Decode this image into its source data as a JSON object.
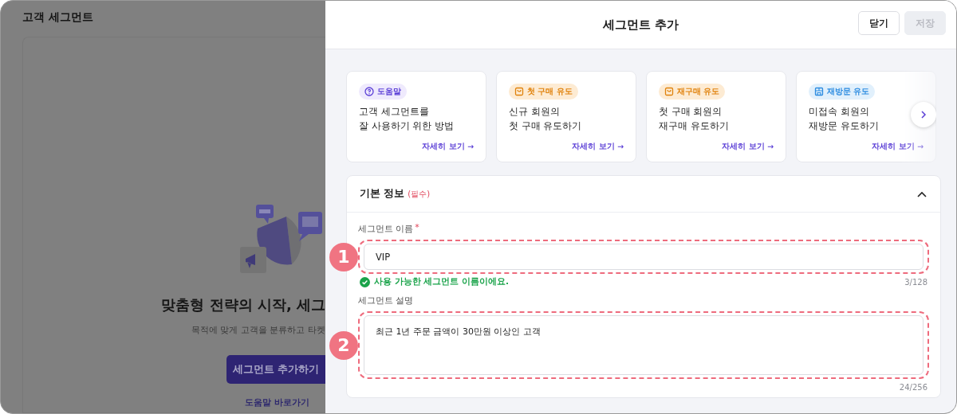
{
  "page": {
    "title": "고객 세그먼트",
    "empty_state": {
      "heading": "맞춤형 전략의 시작, 세그",
      "description": "목적에 맞게 고객을 분류하고 타켓",
      "button": "세그먼트 추가하기",
      "link": "도움말 바로가기"
    }
  },
  "drawer": {
    "title": "세그먼트 추가",
    "buttons": [
      {
        "label": "닫기",
        "disabled": false
      },
      {
        "label": "저장",
        "disabled": true
      }
    ],
    "guide_cards": [
      {
        "kind": "help",
        "badge": "도움말",
        "title": "고객 세그먼트를\n잘 사용하기 위한 방법",
        "link": "자세히 보기 →"
      },
      {
        "kind": "purchase",
        "badge": "첫 구매 유도",
        "title": "신규 회원의\n첫 구매 유도하기",
        "link": "자세히 보기 →"
      },
      {
        "kind": "purchase",
        "badge": "재구매 유도",
        "title": "첫 구매 회원의\n재구매 유도하기",
        "link": "자세히 보기 →"
      },
      {
        "kind": "revisit",
        "badge": "재방문 유도",
        "title": "미접속 회원의\n재방문 유도하기",
        "link": "자세히 보기 →"
      }
    ],
    "section": {
      "title": "기본 정보",
      "required_tag": "(필수)",
      "expanded": true,
      "fields": [
        {
          "kind": "input",
          "label": "세그먼트 이름",
          "required_mark": "*",
          "value": "VIP",
          "message": "사용 가능한 세그먼트 이름이에요.",
          "counter": "3/128",
          "marker": "1"
        },
        {
          "kind": "textarea",
          "label": "세그먼트 설명",
          "value": "최근 1년 주문 금액이 30만원 이상인 고객",
          "counter": "24/256",
          "marker": "2"
        }
      ]
    }
  }
}
